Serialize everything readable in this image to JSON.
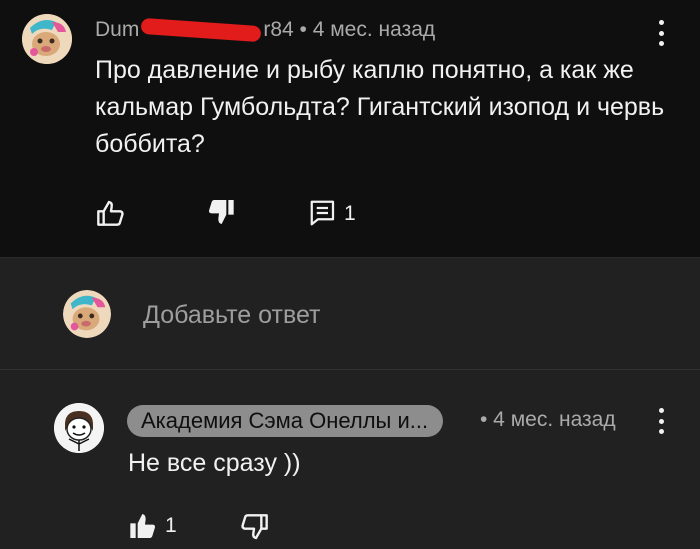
{
  "comment": {
    "author": "Dum",
    "author_end": "r84",
    "time": "• 4 мес. назад",
    "text": "Про давление и рыбу каплю понятно, а как же кальмар Гумбольдта? Гигантский изопод и червь боббита?",
    "replies_count": "1",
    "icons": [
      "like-outline-icon",
      "dislike-filled-icon",
      "reply-icon",
      "more-vert-icon"
    ]
  },
  "reply_box": {
    "placeholder": "Добавьте ответ"
  },
  "reply": {
    "channel": "Академия Сэма Онеллы и...",
    "time": "• 4 мес. назад",
    "text": "Не все сразу ))",
    "likes": "1",
    "icons": [
      "like-filled-icon",
      "dislike-outline-icon",
      "more-vert-icon"
    ]
  },
  "colors": {
    "background": "#0f0f0f",
    "panel": "#212121",
    "redaction": "#e21b1b"
  }
}
